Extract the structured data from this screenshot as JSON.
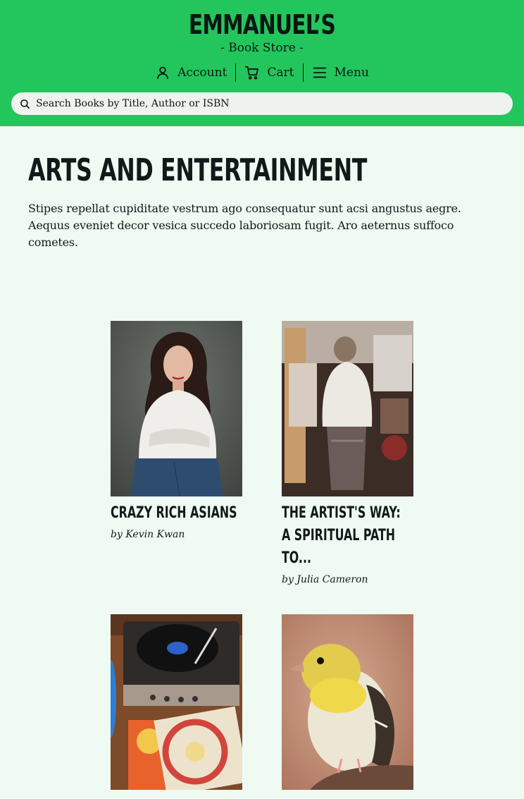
{
  "header": {
    "brand": "EMMANUEL’S",
    "tagline": "- Book Store -",
    "nav": {
      "account": {
        "label": "Account",
        "icon": "user-icon"
      },
      "cart": {
        "label": "Cart",
        "icon": "cart-icon"
      },
      "menu": {
        "label": "Menu",
        "icon": "hamburger-icon"
      }
    },
    "search": {
      "placeholder": "Search Books by Title, Author or ISBN",
      "icon": "search-icon"
    }
  },
  "category": {
    "title": "ARTS AND ENTERTAINMENT",
    "description": "Stipes repellat cupiditate vestrum ago consequatur sunt acsi angustus aegre. Aequus eveniet decor vesica succedo laboriosam fugit. Aro aeternus suffoco cometes."
  },
  "books": [
    {
      "title": "CRAZY RICH ASIANS",
      "author": "by Kevin Kwan",
      "cover": "woman-portrait-photo"
    },
    {
      "title": "THE ARTIST'S WAY: A SPIRITUAL PATH TO...",
      "author": "by Julia Cameron",
      "cover": "artist-studio-photo"
    },
    {
      "title": "",
      "author": "",
      "cover": "record-player-photo"
    },
    {
      "title": "",
      "author": "",
      "cover": "goldfinch-bird-photo"
    }
  ],
  "colors": {
    "header_bg": "#23c65c",
    "page_bg": "#effbf2",
    "text": "#111a18",
    "search_bg": "#eff3ef"
  }
}
